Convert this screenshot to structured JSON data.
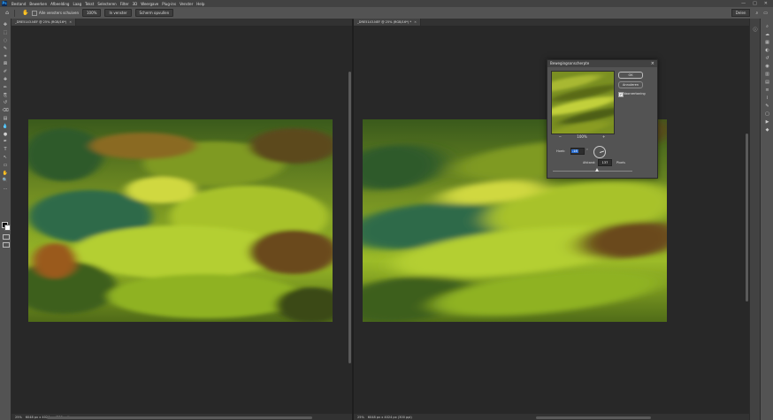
{
  "menu": {
    "items": [
      "Bestand",
      "Bewerken",
      "Afbeelding",
      "Laag",
      "Tekst",
      "Selecteren",
      "Filter",
      "3D",
      "Weergave",
      "Plug-ins",
      "Venster",
      "Help"
    ],
    "window_controls": [
      "—",
      "□",
      "✕"
    ]
  },
  "options_bar": {
    "checkbox_label": "Alle vensters schuiven",
    "zoom_value": "100%",
    "fit_button": "In venster",
    "fill_button": "Scherm opvullen",
    "share_label": "Delen"
  },
  "toolbar": {
    "tools": [
      "move-tool",
      "marquee-tool",
      "lasso-tool",
      "quick-select-tool",
      "crop-tool",
      "frame-tool",
      "eyedropper-tool",
      "healing-tool",
      "brush-tool",
      "clone-stamp-tool",
      "history-brush-tool",
      "eraser-tool",
      "gradient-tool",
      "blur-tool",
      "dodge-tool",
      "pen-tool",
      "type-tool",
      "path-select-tool",
      "rectangle-tool",
      "hand-tool",
      "zoom-tool",
      "more-tools"
    ],
    "glyphs": [
      "✥",
      "⬚",
      "◌",
      "✎",
      "⌗",
      "⊠",
      "✐",
      "✚",
      "✏",
      "⎘",
      "↺",
      "⌫",
      "▤",
      "💧",
      "●",
      "✒",
      "T",
      "↖",
      "▭",
      "✋",
      "🔍",
      "…"
    ]
  },
  "documents": {
    "left": {
      "tab_label": "_DRE5143.NEF @ 25% (RGB/16*)",
      "zoom": "25%",
      "doc_info": "6048 px x 4024 px (300 ppi)"
    },
    "right": {
      "tab_label": "_DRE5143.NEF @ 25% (RGB/16*) *",
      "zoom": "25%",
      "doc_info": "6048 px x 4024 px (300 ppi)"
    }
  },
  "dialog": {
    "title": "Bewegingsonscherpte",
    "ok_label": "OK",
    "cancel_label": "Annuleren",
    "preview_label": "Voorvertoning",
    "preview_checked": "✓",
    "zoom_out": "−",
    "zoom_level": "100%",
    "zoom_in": "+",
    "angle_label": "Hoek:",
    "angle_value": "-18",
    "angle_unit": "°",
    "distance_label": "Afstand:",
    "distance_value": "137",
    "distance_unit": "Pixels",
    "slider_fraction": 0.55
  },
  "dock_icons": [
    "search-icon",
    "cloud-icon",
    "layers-icon",
    "adjustments-icon",
    "history-icon",
    "color-icon",
    "swatches-icon",
    "gradients-icon",
    "properties-icon",
    "paths-icon",
    "brushes-icon",
    "comments-icon",
    "play-icon",
    "shapes-icon"
  ],
  "dock_glyphs": [
    "⌕",
    "☁",
    "▦",
    "◐",
    "↺",
    "◉",
    "▥",
    "▤",
    "≡",
    "⌇",
    "✎",
    "▢",
    "▶",
    "◆"
  ],
  "colors": {
    "chrome_dark": "#424242",
    "chrome": "#535353",
    "canvas_bg": "#282828",
    "accent_selection": "#2a6ed1"
  }
}
